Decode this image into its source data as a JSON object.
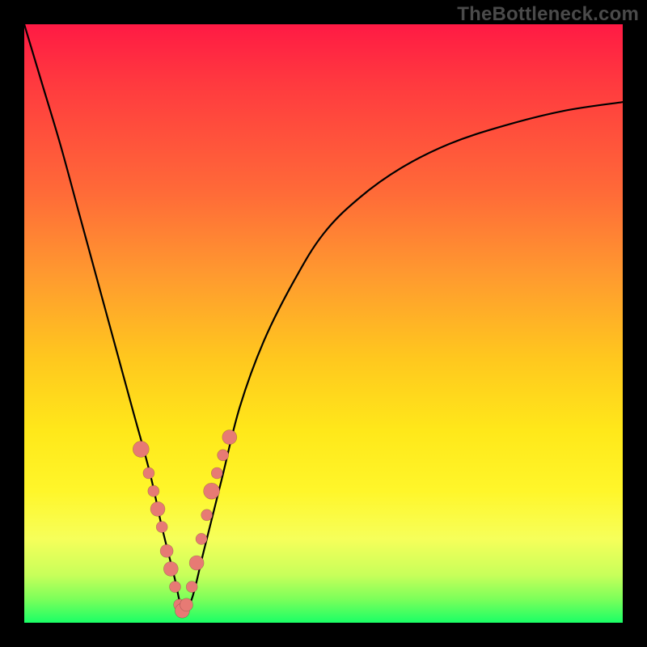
{
  "watermark": "TheBottleneck.com",
  "colors": {
    "frame": "#000000",
    "point_fill": "#e77a74",
    "curve_stroke": "#000000"
  },
  "chart_data": {
    "type": "line",
    "title": "",
    "xlabel": "",
    "ylabel": "",
    "xlim": [
      0,
      100
    ],
    "ylim": [
      0,
      100
    ],
    "note": "No axis ticks or numeric labels are present in the image; x and y values are estimates on a 0–100 plot-area scale. y represents height above the plot bottom (higher = closer to red, 0 = green bottom).",
    "grid": false,
    "legend": false,
    "series": [
      {
        "name": "bottleneck-curve",
        "x": [
          0,
          3,
          6,
          9,
          12,
          15,
          18,
          21,
          23,
          25,
          26.5,
          28,
          30,
          33,
          36,
          40,
          45,
          50,
          56,
          63,
          71,
          80,
          90,
          100
        ],
        "y": [
          100,
          90,
          80,
          69,
          58,
          47,
          36,
          25,
          16,
          8,
          2,
          4,
          12,
          24,
          36,
          47,
          57,
          65,
          71,
          76,
          80,
          83,
          85.5,
          87
        ]
      }
    ],
    "points_overlay": {
      "name": "highlighted-points",
      "note": "Salmon dotted markers clustered along the lower V portion of the curve (both descending and ascending arms).",
      "x": [
        19.5,
        20.8,
        21.6,
        22.3,
        23.0,
        23.8,
        24.5,
        25.2,
        25.9,
        26.4,
        27.1,
        28.0,
        28.8,
        29.6,
        30.5,
        31.3,
        32.2,
        33.2,
        34.3
      ],
      "y": [
        29,
        25,
        22,
        19,
        16,
        12,
        9,
        6,
        3,
        2,
        3,
        6,
        10,
        14,
        18,
        22,
        25,
        28,
        31
      ]
    }
  }
}
